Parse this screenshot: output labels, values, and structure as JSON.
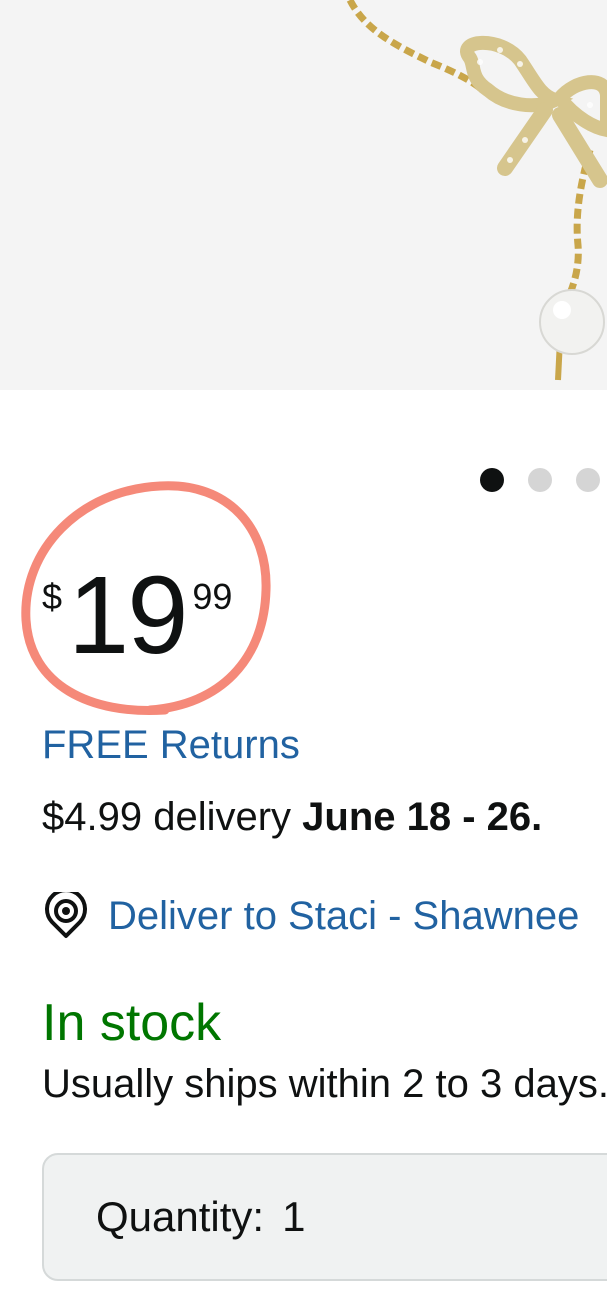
{
  "product": {
    "image_alt": "gold chain bracelet with rhinestone bow and pearl charm",
    "image_dots": [
      {
        "active": true
      },
      {
        "active": false
      },
      {
        "active": false
      }
    ]
  },
  "price": {
    "symbol": "$",
    "whole": "19",
    "fraction": "99",
    "annotation_color": "#f47c6a"
  },
  "returns": {
    "label": "FREE Returns"
  },
  "delivery": {
    "prefix": "$4.99 delivery ",
    "date": "June 18 - 26."
  },
  "deliver_to": {
    "icon": "location-pin-icon",
    "label": "Deliver to Staci - Shawnee"
  },
  "availability": {
    "status": "In stock",
    "shipping_note": "Usually ships within 2 to 3 days."
  },
  "quantity": {
    "label": "Quantity:",
    "value": "1"
  },
  "colors": {
    "link": "#2162a1",
    "in_stock": "#007600",
    "text": "#0f1111"
  }
}
